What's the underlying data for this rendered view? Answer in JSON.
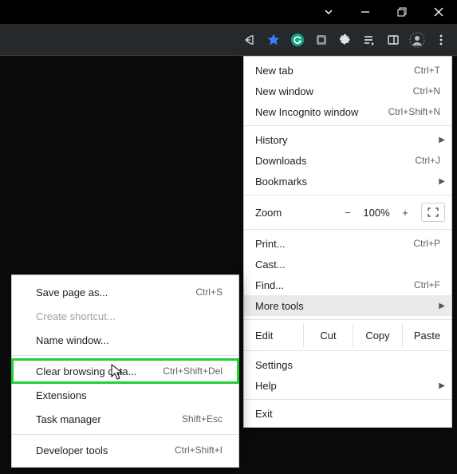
{
  "titlebar": {
    "dropdown": "⌄",
    "minimize": "—",
    "maximize": "❐",
    "close": "✕"
  },
  "toolbar": {
    "share_icon": "share",
    "star_icon": "star",
    "g_icon": "G",
    "ext1_icon": "ext",
    "puzzle_icon": "puzzle",
    "list_icon": "list",
    "cast_icon": "cast",
    "avatar_icon": "avatar",
    "kebab_icon": "⋮"
  },
  "menu": {
    "new_tab": {
      "label": "New tab",
      "shortcut": "Ctrl+T"
    },
    "new_window": {
      "label": "New window",
      "shortcut": "Ctrl+N"
    },
    "new_incognito": {
      "label": "New Incognito window",
      "shortcut": "Ctrl+Shift+N"
    },
    "history": {
      "label": "History"
    },
    "downloads": {
      "label": "Downloads",
      "shortcut": "Ctrl+J"
    },
    "bookmarks": {
      "label": "Bookmarks"
    },
    "zoom": {
      "label": "Zoom",
      "minus": "−",
      "value": "100%",
      "plus": "+"
    },
    "print": {
      "label": "Print...",
      "shortcut": "Ctrl+P"
    },
    "cast": {
      "label": "Cast..."
    },
    "find": {
      "label": "Find...",
      "shortcut": "Ctrl+F"
    },
    "more_tools": {
      "label": "More tools"
    },
    "edit": {
      "label": "Edit",
      "cut": "Cut",
      "copy": "Copy",
      "paste": "Paste"
    },
    "settings": {
      "label": "Settings"
    },
    "help": {
      "label": "Help"
    },
    "exit": {
      "label": "Exit"
    }
  },
  "submenu": {
    "save_page": {
      "label": "Save page as...",
      "shortcut": "Ctrl+S"
    },
    "create_shortcut": {
      "label": "Create shortcut..."
    },
    "name_window": {
      "label": "Name window..."
    },
    "clear_browsing": {
      "label": "Clear browsing data...",
      "shortcut": "Ctrl+Shift+Del"
    },
    "extensions": {
      "label": "Extensions"
    },
    "task_manager": {
      "label": "Task manager",
      "shortcut": "Shift+Esc"
    },
    "developer_tools": {
      "label": "Developer tools",
      "shortcut": "Ctrl+Shift+I"
    }
  }
}
